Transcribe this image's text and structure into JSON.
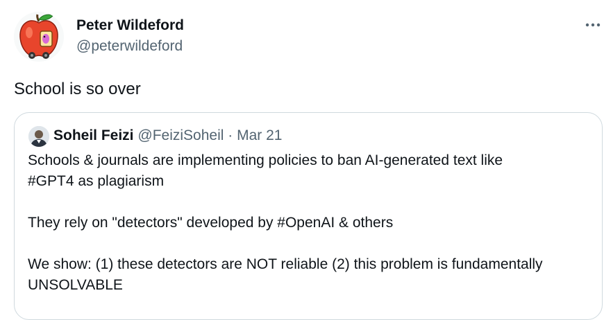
{
  "tweet": {
    "author_name": "Peter Wildeford",
    "author_handle": "@peterwildeford",
    "text": "School is so over",
    "avatar_icon": "apple-character-icon",
    "more_icon": "more-options-icon"
  },
  "quoted_tweet": {
    "author_name": "Soheil Feizi",
    "author_handle": "@FeiziSoheil",
    "separator": "·",
    "date": "Mar 21",
    "lines": [
      "Schools & journals are implementing policies to ban AI-generated text like",
      "#GPT4 as plagiarism",
      "They rely on \"detectors\" developed by #OpenAI & others",
      "We show: (1) these detectors are NOT reliable (2) this problem is fundamentally",
      "UNSOLVABLE"
    ]
  },
  "colors": {
    "text_primary": "#0f1419",
    "text_secondary": "#536471",
    "border": "#cfd9de",
    "background": "#ffffff"
  }
}
